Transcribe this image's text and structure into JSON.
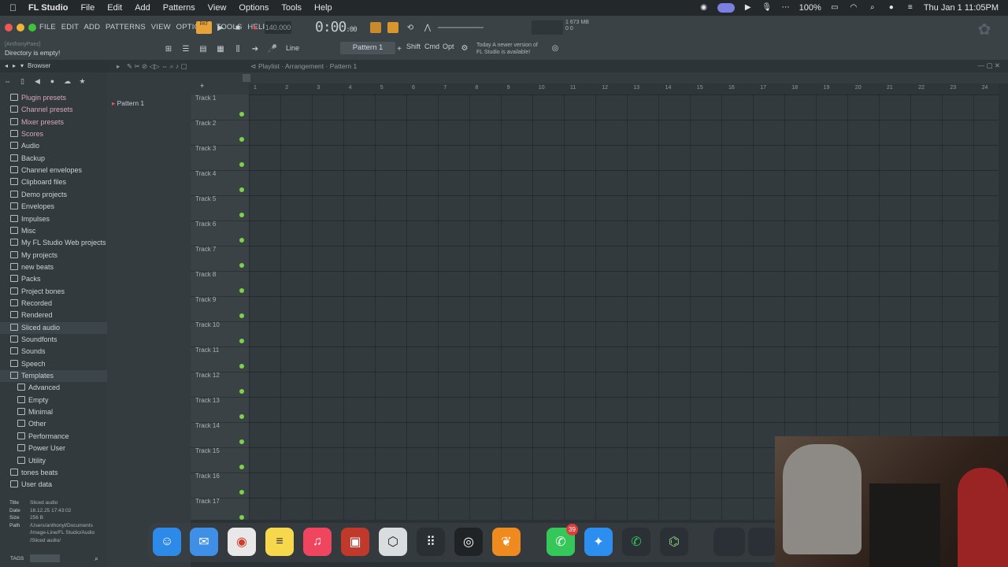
{
  "menubar": {
    "app_name": "FL Studio",
    "items": [
      "File",
      "Edit",
      "Add",
      "Patterns",
      "View",
      "Options",
      "Tools",
      "Help"
    ],
    "battery": "100%",
    "datetime": "Thu Jan 1  11:05PM"
  },
  "fl": {
    "menu": [
      "FILE",
      "EDIT",
      "ADD",
      "PATTERNS",
      "VIEW",
      "OPTIONS",
      "TOOLS",
      "HELP"
    ],
    "user_hint": "[AnthonyPaez]",
    "status_hint": "Directory is empty!",
    "tempo": "140.000",
    "time_main": "0:00",
    "time_sub": ":00",
    "snap": "Line",
    "pattern": "Pattern 1",
    "keys": [
      "Shift",
      "Cmd",
      "Opt"
    ],
    "news_line1": "Today  A newer version of",
    "news_line2": "FL Studio is available!",
    "cpu_line1": "1        673 MB",
    "cpu_line2": "0            0",
    "pattern_badge": "PAT"
  },
  "browser": {
    "title": "Browser",
    "items": [
      {
        "label": "Plugin presets",
        "style": "pink"
      },
      {
        "label": "Channel presets",
        "style": "pink"
      },
      {
        "label": "Mixer presets",
        "style": "pink"
      },
      {
        "label": "Scores",
        "style": "pink"
      },
      {
        "label": "Audio",
        "style": "normal"
      },
      {
        "label": "Backup",
        "style": "normal"
      },
      {
        "label": "Channel envelopes",
        "style": "normal"
      },
      {
        "label": "Clipboard files",
        "style": "normal"
      },
      {
        "label": "Demo projects",
        "style": "normal"
      },
      {
        "label": "Envelopes",
        "style": "normal"
      },
      {
        "label": "Impulses",
        "style": "normal"
      },
      {
        "label": "Misc",
        "style": "normal"
      },
      {
        "label": "My FL Studio Web projects",
        "style": "normal"
      },
      {
        "label": "My projects",
        "style": "normal"
      },
      {
        "label": "new beats",
        "style": "normal"
      },
      {
        "label": "Packs",
        "style": "normal"
      },
      {
        "label": "Project bones",
        "style": "normal"
      },
      {
        "label": "Recorded",
        "style": "normal"
      },
      {
        "label": "Rendered",
        "style": "normal"
      },
      {
        "label": "Sliced audio",
        "style": "hl"
      },
      {
        "label": "Soundfonts",
        "style": "normal"
      },
      {
        "label": "Sounds",
        "style": "normal"
      },
      {
        "label": "Speech",
        "style": "normal"
      },
      {
        "label": "Templates",
        "style": "hl"
      },
      {
        "label": "Advanced",
        "style": "sub"
      },
      {
        "label": "Empty",
        "style": "sub"
      },
      {
        "label": "Minimal",
        "style": "sub"
      },
      {
        "label": "Other",
        "style": "sub"
      },
      {
        "label": "Performance",
        "style": "sub"
      },
      {
        "label": "Power User",
        "style": "sub"
      },
      {
        "label": "Utility",
        "style": "sub"
      },
      {
        "label": "tones beats",
        "style": "normal"
      },
      {
        "label": "User data",
        "style": "normal"
      }
    ],
    "info": {
      "title_label": "Title",
      "title": "Sliced audio",
      "date_label": "Date",
      "date": "16.12.25 17:43:02",
      "size_label": "Size",
      "size": "256 B",
      "path_label": "Path",
      "path1": "/Users/anthonyl/Documents",
      "path2": "/Image-Line/FL Studio/Audio",
      "path3": "/Sliced audio/"
    },
    "tags": "TAGS"
  },
  "playlist": {
    "breadcrumb": "Playlist · Arrangement · Pattern 1",
    "picker_item": "Pattern 1",
    "tracks": [
      "Track 1",
      "Track 2",
      "Track 3",
      "Track 4",
      "Track 5",
      "Track 6",
      "Track 7",
      "Track 8",
      "Track 9",
      "Track 10",
      "Track 11",
      "Track 12",
      "Track 13",
      "Track 14",
      "Track 15",
      "Track 16",
      "Track 17"
    ],
    "ruler": [
      "1",
      "2",
      "3",
      "4",
      "5",
      "6",
      "7",
      "8",
      "9",
      "10",
      "11",
      "12",
      "13",
      "14",
      "15",
      "16",
      "17",
      "18",
      "19",
      "20",
      "21",
      "22",
      "23",
      "24"
    ]
  },
  "dock": {
    "apps": [
      "finder-icon",
      "mail-icon",
      "chrome-icon",
      "notes-icon",
      "music-icon",
      "photo-booth-icon",
      "davinci-icon",
      "launchpad-icon",
      "obs-icon",
      "fl-studio-icon",
      "messages-icon",
      "safari-icon",
      "phone-icon",
      "app-icon",
      "window-thumb-icon"
    ],
    "messages_badge": "39"
  }
}
